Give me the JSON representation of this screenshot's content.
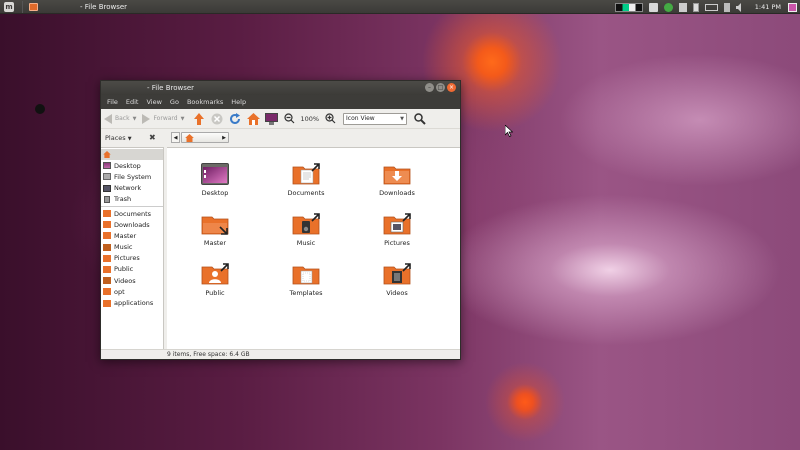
{
  "panel": {
    "menu_logo": "m",
    "task_title": "- File Browser",
    "clock": "1:41 PM"
  },
  "window": {
    "title": "- File Browser",
    "menus": [
      "File",
      "Edit",
      "View",
      "Go",
      "Bookmarks",
      "Help"
    ],
    "toolbar": {
      "back_label": "Back",
      "forward_label": "Forward",
      "zoom_level": "100%",
      "view_mode": "Icon View"
    },
    "places_label": "Places",
    "places_items": [
      {
        "label": "",
        "icon": "home-icon"
      },
      {
        "label": "Desktop",
        "icon": "desktop-icon"
      },
      {
        "label": "File System",
        "icon": "drive-icon"
      },
      {
        "label": "Network",
        "icon": "network-icon"
      },
      {
        "label": "Trash",
        "icon": "trash-icon"
      }
    ],
    "bookmark_items": [
      {
        "label": "Documents",
        "icon": "folder-documents-icon"
      },
      {
        "label": "Downloads",
        "icon": "folder-downloads-icon"
      },
      {
        "label": "Master",
        "icon": "folder-icon"
      },
      {
        "label": "Music",
        "icon": "folder-music-icon"
      },
      {
        "label": "Pictures",
        "icon": "folder-pictures-icon"
      },
      {
        "label": "Public",
        "icon": "folder-public-icon"
      },
      {
        "label": "Videos",
        "icon": "folder-videos-icon"
      },
      {
        "label": "opt",
        "icon": "folder-icon"
      },
      {
        "label": "applications",
        "icon": "folder-icon"
      }
    ],
    "files": [
      {
        "label": "Desktop",
        "icon": "desktop-folder-icon"
      },
      {
        "label": "Documents",
        "icon": "documents-folder-icon"
      },
      {
        "label": "Downloads",
        "icon": "downloads-folder-icon"
      },
      {
        "label": "Master",
        "icon": "master-folder-icon"
      },
      {
        "label": "Music",
        "icon": "music-folder-icon"
      },
      {
        "label": "Pictures",
        "icon": "pictures-folder-icon"
      },
      {
        "label": "Public",
        "icon": "public-folder-icon"
      },
      {
        "label": "Templates",
        "icon": "templates-folder-icon"
      },
      {
        "label": "Videos",
        "icon": "videos-folder-icon"
      }
    ],
    "status": "9 items, Free space: 6.4 GB"
  },
  "colors": {
    "accent_orange": "#e9712a",
    "panel_dark": "#3c3b38",
    "window_bg": "#efeeeb"
  }
}
